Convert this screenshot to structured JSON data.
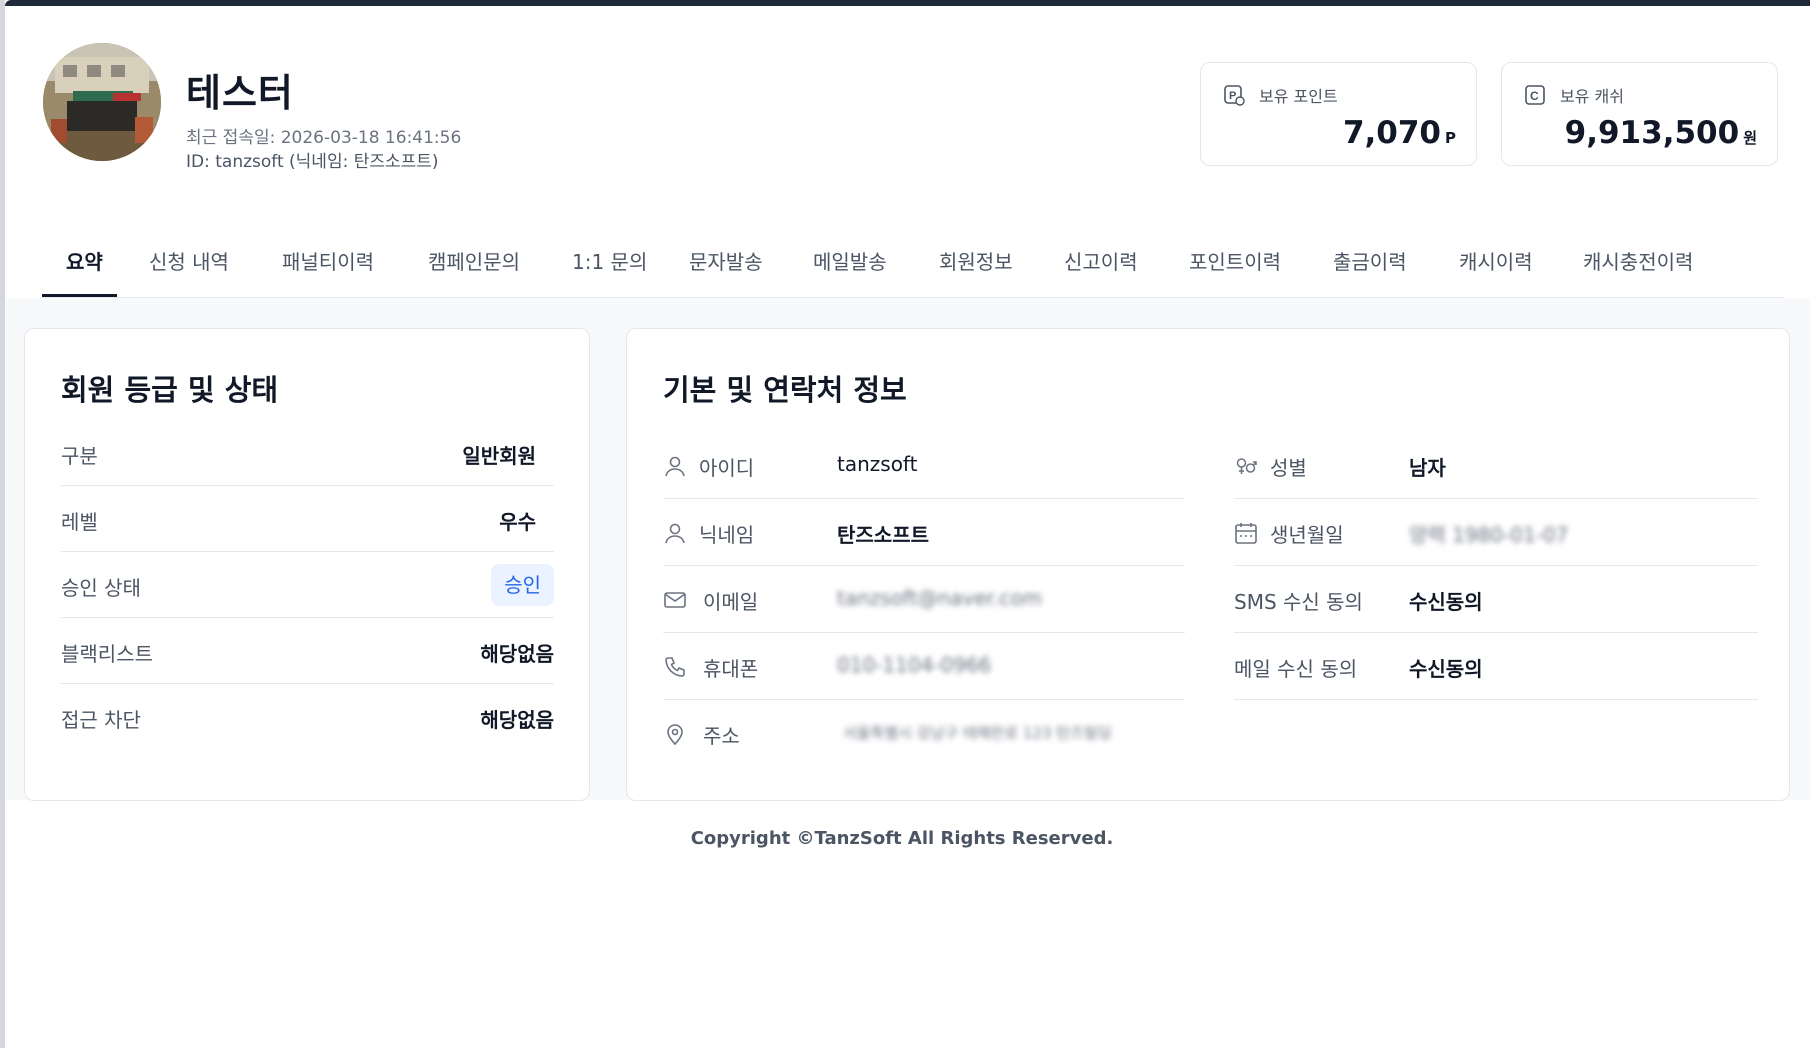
{
  "profile": {
    "name": "테스터",
    "last_login": "최근 접속일: 2026-03-18 16:41:56",
    "id_line": "ID: tanzsoft (닉네임: 탄즈소프트)"
  },
  "stats": {
    "points": {
      "label": "보유 포인트",
      "value": "7,070",
      "unit": "P",
      "icon": "point-icon"
    },
    "cash": {
      "label": "보유 캐쉬",
      "value": "9,913,500",
      "unit": "원",
      "icon": "cash-icon"
    }
  },
  "tabs": [
    {
      "label": "요약",
      "active": true
    },
    {
      "label": "신청 내역"
    },
    {
      "label": "패널티이력"
    },
    {
      "label": "캠페인문의"
    },
    {
      "label": "1:1 문의"
    },
    {
      "label": "문자발송"
    },
    {
      "label": "메일발송"
    },
    {
      "label": "회원정보"
    },
    {
      "label": "신고이력"
    },
    {
      "label": "포인트이력"
    },
    {
      "label": "출금이력"
    },
    {
      "label": "캐시이력"
    },
    {
      "label": "캐시충전이력"
    }
  ],
  "grade_card": {
    "title": "회원 등급 및 상태",
    "rows": [
      {
        "key": "구분",
        "value": "일반회원"
      },
      {
        "key": "레벨",
        "value": "우수"
      },
      {
        "key": "승인 상태",
        "value": "승인"
      },
      {
        "key": "블랙리스트",
        "value": "해당없음"
      },
      {
        "key": "접근 차단",
        "value": "해당없음"
      }
    ]
  },
  "contact_card": {
    "title": "기본 및 연락처 정보",
    "left": [
      {
        "icon": "user-icon",
        "key": "아이디",
        "value": "tanzsoft"
      },
      {
        "icon": "user-icon",
        "key": "닉네임",
        "value": "탄즈소프트"
      },
      {
        "icon": "mail-icon",
        "key": "이메일",
        "value": "tanzsoft@naver.com"
      },
      {
        "icon": "phone-icon",
        "key": "휴대폰",
        "value": "010-1104-0966"
      },
      {
        "icon": "location-icon",
        "key": "주소",
        "value": "서울특별시 강남구 테헤란로 123 탄즈빌딩"
      }
    ],
    "right": [
      {
        "icon": "gender-icon",
        "key": "성별",
        "value": "남자"
      },
      {
        "icon": "calendar-icon",
        "key": "생년월일",
        "value": "양력 1980-01-07"
      },
      {
        "key": "SMS 수신 동의",
        "value": "수신동의"
      },
      {
        "key": "메일 수신 동의",
        "value": "수신동의"
      }
    ]
  },
  "footer": {
    "text": "Copyright ©TanzSoft All Rights Reserved."
  },
  "colors": {
    "accent": "#111827",
    "badge_bg": "#eaf3ff",
    "badge_text": "#2563eb",
    "page_bg": "#f8f9fb"
  }
}
